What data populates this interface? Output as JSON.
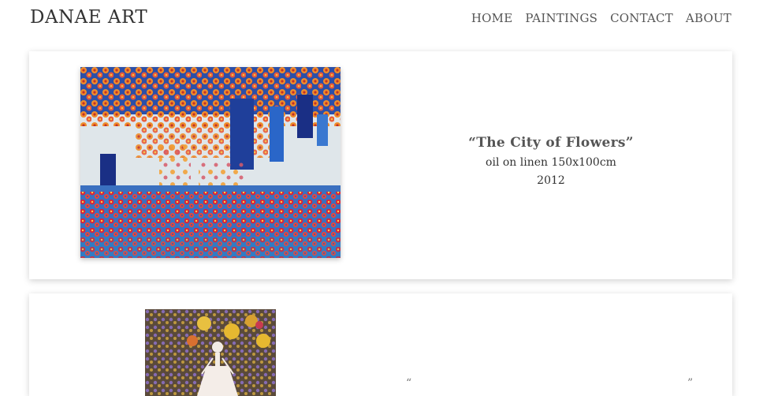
{
  "site": {
    "title": "DANAE ART"
  },
  "nav": {
    "items": [
      {
        "label": "HOME"
      },
      {
        "label": "PAINTINGS"
      },
      {
        "label": "CONTACT"
      },
      {
        "label": "ABOUT"
      }
    ]
  },
  "paintings": [
    {
      "title": "“The City of Flowers”",
      "medium": "oil on linen 150x100cm",
      "year": "2012"
    },
    {
      "title": "“",
      "title_end": "”"
    }
  ],
  "colors": {
    "text": "#333333",
    "nav": "#555555",
    "background": "#ffffff"
  }
}
